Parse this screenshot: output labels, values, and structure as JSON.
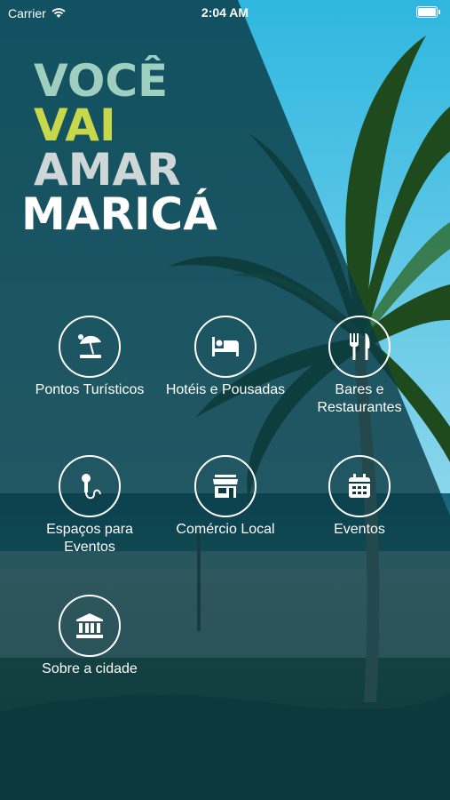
{
  "status_bar": {
    "carrier": "Carrier",
    "time": "2:04 AM"
  },
  "logo": {
    "line1": "VOCÊ",
    "line2": "VAI",
    "line3": "AMAR",
    "line4": "MARICÁ"
  },
  "menu": [
    {
      "label": "Pontos Turísticos",
      "icon": "beach-umbrella-icon"
    },
    {
      "label": "Hotéis e Pousadas",
      "icon": "bed-icon"
    },
    {
      "label_line1": "Bares e",
      "label_line2": "Restaurantes",
      "icon": "fork-knife-icon"
    },
    {
      "label_line1": "Espaços para",
      "label_line2": "Eventos",
      "icon": "microphone-icon"
    },
    {
      "label": "Comércio Local",
      "icon": "store-icon"
    },
    {
      "label": "Eventos",
      "icon": "calendar-icon"
    },
    {
      "label": "Sobre a cidade",
      "icon": "museum-icon"
    }
  ],
  "colors": {
    "overlay": "#0b3b44",
    "sky": "#3cb9dc",
    "logo_accent": "#9fcfbf",
    "logo_lime": "#c8d84a"
  }
}
